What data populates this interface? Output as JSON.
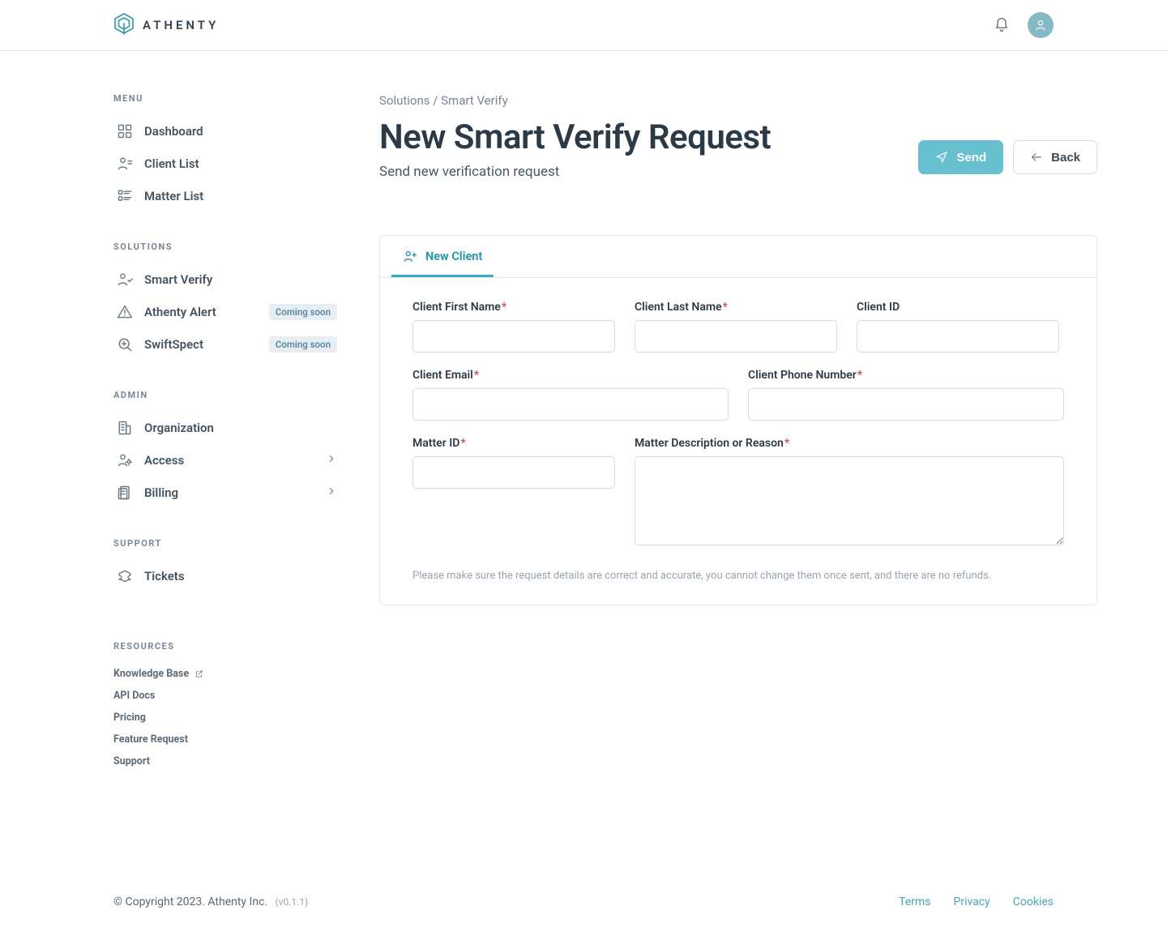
{
  "brand": {
    "name": "ATHENTY"
  },
  "sidebar": {
    "sections": [
      {
        "title": "MENU",
        "items": [
          {
            "label": "Dashboard"
          },
          {
            "label": "Client List"
          },
          {
            "label": "Matter List"
          }
        ]
      },
      {
        "title": "SOLUTIONS",
        "items": [
          {
            "label": "Smart Verify"
          },
          {
            "label": "Athenty Alert",
            "badge": "Coming soon"
          },
          {
            "label": "SwiftSpect",
            "badge": "Coming soon"
          }
        ]
      },
      {
        "title": "ADMIN",
        "items": [
          {
            "label": "Organization"
          },
          {
            "label": "Access",
            "expandable": true
          },
          {
            "label": "Billing",
            "expandable": true
          }
        ]
      },
      {
        "title": "SUPPORT",
        "items": [
          {
            "label": "Tickets"
          }
        ]
      },
      {
        "title": "RESOURCES",
        "links": [
          {
            "label": "Knowledge Base",
            "external": true
          },
          {
            "label": "API Docs"
          },
          {
            "label": "Pricing"
          },
          {
            "label": "Feature Request"
          },
          {
            "label": "Support"
          }
        ]
      }
    ]
  },
  "breadcrumb": "Solutions / Smart Verify",
  "title": "New Smart Verify Request",
  "subtitle": "Send new verification request",
  "buttons": {
    "send": "Send",
    "back": "Back"
  },
  "form": {
    "tab": "New Client",
    "fields": {
      "first_name": "Client First Name",
      "last_name": "Client Last Name",
      "client_id": "Client ID",
      "email": "Client Email",
      "phone": "Client Phone Number",
      "matter_id": "Matter ID",
      "matter_desc": "Matter Description or Reason"
    },
    "hint": "Please make sure the request details are correct and accurate, you cannot change them once sent, and there are no refunds."
  },
  "footer": {
    "copyright": "© Copyright 2023. Athenty Inc.",
    "version": "(v0.1.1)",
    "links": [
      "Terms",
      "Privacy",
      "Cookies"
    ]
  }
}
